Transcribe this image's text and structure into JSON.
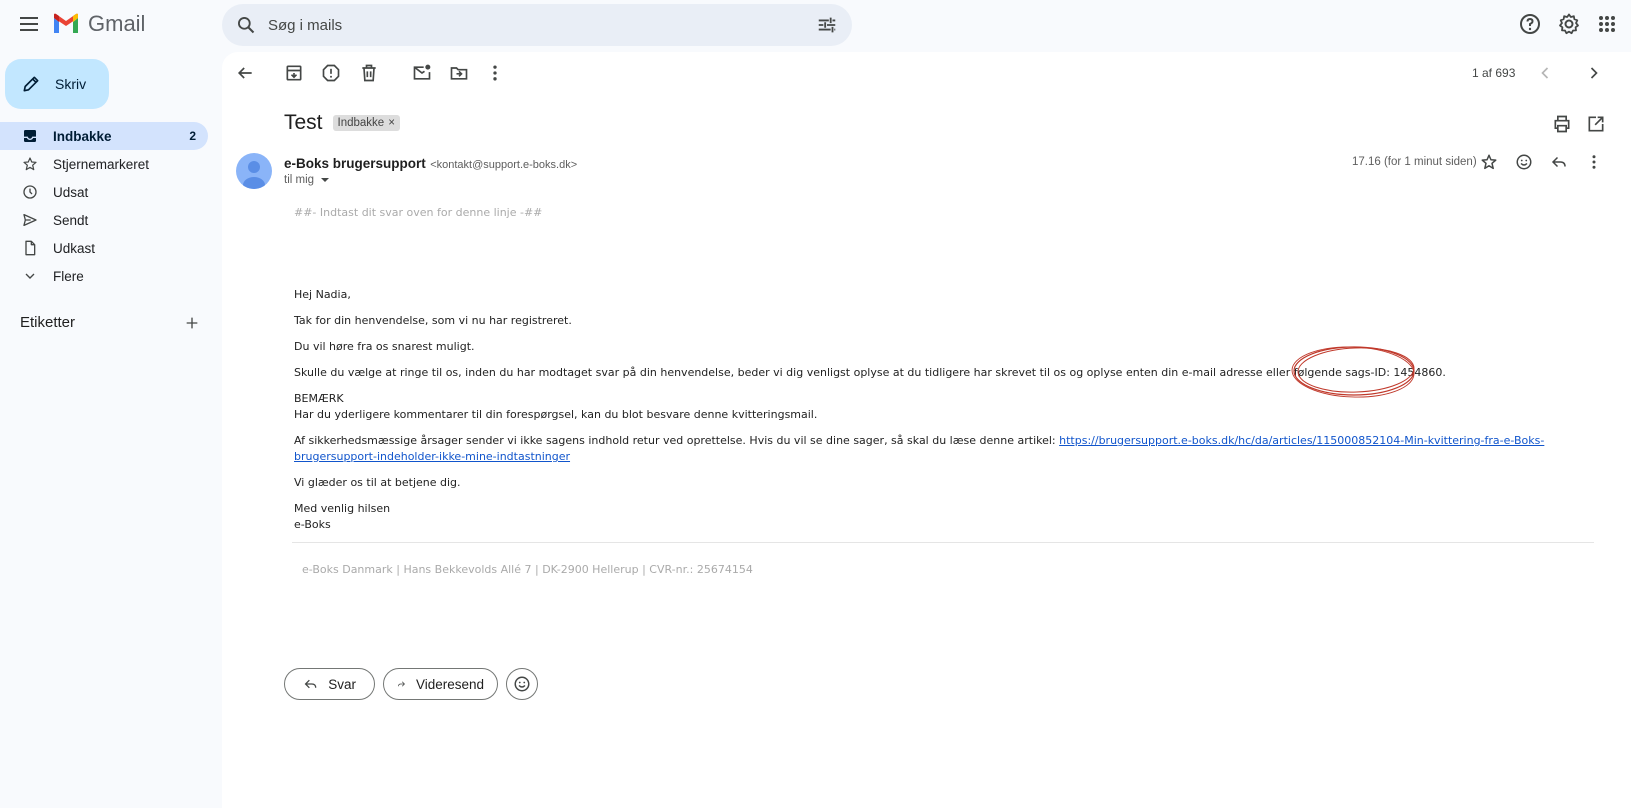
{
  "header": {
    "app_name": "Gmail",
    "search_placeholder": "Søg i mails"
  },
  "sidebar": {
    "compose_label": "Skriv",
    "items": [
      {
        "label": "Indbakke",
        "count": "2",
        "icon": "inbox-icon"
      },
      {
        "label": "Stjernemarkeret",
        "count": "",
        "icon": "star-icon"
      },
      {
        "label": "Udsat",
        "count": "",
        "icon": "clock-icon"
      },
      {
        "label": "Sendt",
        "count": "",
        "icon": "send-icon"
      },
      {
        "label": "Udkast",
        "count": "",
        "icon": "draft-icon"
      },
      {
        "label": "Flere",
        "count": "",
        "icon": "chevron-down-icon"
      }
    ],
    "labels_heading": "Etiketter"
  },
  "toolbar": {
    "pager": "1 af 693"
  },
  "email": {
    "subject": "Test",
    "label_chip": "Indbakke",
    "sender_name": "e-Boks brugersupport",
    "sender_email": "<kontakt@support.e-boks.dk>",
    "to_me": "til mig",
    "time": "17.16 (for 1 minut siden)",
    "body": {
      "reply_line": "##- Indtast dit svar oven for denne linje -##",
      "greeting": "Hej Nadia,",
      "p1": "Tak for din henvendelse, som vi nu har registreret.",
      "p2": "Du vil høre fra os snarest muligt.",
      "p3": "Skulle du vælge at ringe til os, inden du har modtaget svar på din henvendelse, beder vi dig venligst oplyse at du tidligere har skrevet til os og oplyse enten din e-mail adresse eller følgende sags-ID: 1454860.",
      "note_title": "BEMÆRK",
      "note_text": "Har du yderligere kommentarer til din forespørgsel, kan du blot besvare denne kvitteringsmail.",
      "p4_prefix": "Af sikkerhedsmæssige årsager sender vi ikke sagens indhold retur ved oprettelse. Hvis du vil se dine sager, så skal du læse denne artikel: ",
      "p4_link": "https://brugersupport.e-boks.dk/hc/da/articles/115000852104-Min-kvittering-fra-e-Boks-brugersupport-indeholder-ikke-mine-indtastninger",
      "p5": "Vi glæder os til at betjene dig.",
      "signoff": "Med venlig hilsen",
      "signature": "e-Boks",
      "footer": "e-Boks Danmark | Hans Bekkevolds Allé 7 | DK-2900 Hellerup | CVR-nr.: 25674154"
    }
  },
  "actions": {
    "reply": "Svar",
    "forward": "Videresend"
  },
  "colors": {
    "accent": "#c2e7ff",
    "active_nav": "#d3e3fd",
    "link": "#1155cc",
    "annotation": "#c0392b"
  }
}
